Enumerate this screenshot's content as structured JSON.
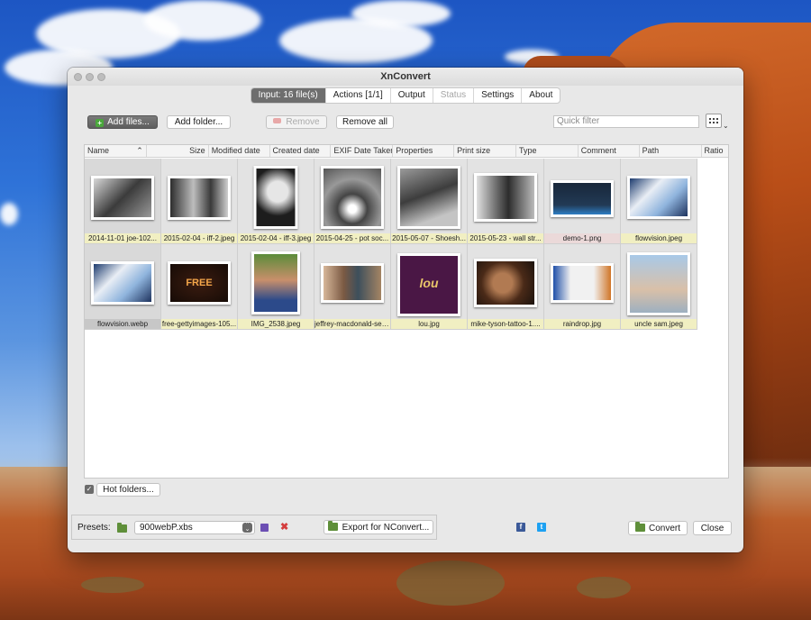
{
  "window": {
    "title": "XnConvert",
    "tabs": [
      {
        "label": "Input: 16 file(s)",
        "state": "active"
      },
      {
        "label": "Actions [1/1]",
        "state": "normal"
      },
      {
        "label": "Output",
        "state": "normal"
      },
      {
        "label": "Status",
        "state": "disabled"
      },
      {
        "label": "Settings",
        "state": "normal"
      },
      {
        "label": "About",
        "state": "normal"
      }
    ]
  },
  "toolbar": {
    "add_files": "Add files...",
    "add_folder": "Add folder...",
    "remove": "Remove",
    "remove_all": "Remove all",
    "filter_placeholder": "Quick filter",
    "view_icon": "grid-view-icon"
  },
  "columns": [
    "Name",
    "Size",
    "Modified date",
    "Created date",
    "EXIF Date Taken",
    "Properties",
    "Print size",
    "Type",
    "Comment",
    "Path",
    "Ratio"
  ],
  "files": [
    {
      "name": "2014-11-01 joe-102...",
      "caption": "yellow",
      "selected": true
    },
    {
      "name": "2015-02-04 - iff-2.jpeg",
      "caption": "yellow",
      "selected": false
    },
    {
      "name": "2015-02-04 - iff-3.jpeg",
      "caption": "yellow",
      "selected": false
    },
    {
      "name": "2015-04-25 - pot soc...",
      "caption": "yellow",
      "selected": false
    },
    {
      "name": "2015-05-07 - Shoesh...",
      "caption": "yellow",
      "selected": false
    },
    {
      "name": "2015-05-23 - wall str...",
      "caption": "yellow",
      "selected": false
    },
    {
      "name": "demo-1.png",
      "caption": "pink",
      "selected": false
    },
    {
      "name": "flowvision.jpeg",
      "caption": "yellow",
      "selected": false
    },
    {
      "name": "flowvision.webp",
      "caption": "gray",
      "selected": true
    },
    {
      "name": "free-gettyimages-105...",
      "caption": "yellow",
      "selected": false
    },
    {
      "name": "IMG_2538.jpeg",
      "caption": "yellow",
      "selected": false
    },
    {
      "name": "jeffrey-macdonald-see...",
      "caption": "yellow",
      "selected": false
    },
    {
      "name": "lou.jpg",
      "caption": "yellow",
      "selected": false
    },
    {
      "name": "mike-tyson-tattoo-1....",
      "caption": "yellow",
      "selected": false
    },
    {
      "name": "raindrop.jpg",
      "caption": "yellow",
      "selected": false
    },
    {
      "name": "uncle sam.jpeg",
      "caption": "yellow",
      "selected": false
    }
  ],
  "thumb_text": {
    "free": "FREE",
    "lou": "lou"
  },
  "bottom": {
    "hot_folders": "Hot folders...",
    "presets_label": "Presets:",
    "preset_value": "900webP.xbs",
    "export": "Export for NConvert...",
    "convert": "Convert",
    "close": "Close"
  },
  "colors": {
    "active_tab": "#6e6e6e",
    "caption_yellow": "#f1efc2",
    "caption_pink": "#ebd9d9",
    "facebook": "#3b5998",
    "twitter": "#1da1f2"
  }
}
